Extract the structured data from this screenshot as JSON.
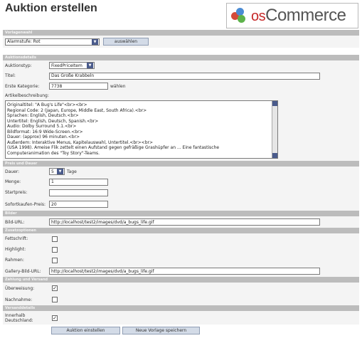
{
  "header": {
    "title": "Auktion erstellen",
    "logo_text_os": "os",
    "logo_text_main": "Commerce"
  },
  "sections": {
    "template": "Vorlagenwahl",
    "details": "Auktionsdetails",
    "price": "Preis und Dauer",
    "images": "Bilder",
    "options": "Zusatzoptionen",
    "shipping": "Zahlung und Versand",
    "other": "Versanddetails"
  },
  "template": {
    "value": "Alarmstufe: Rot",
    "button": "auswählen"
  },
  "details": {
    "type_label": "Auktionstyp:",
    "type_value": "FixedPriceItem",
    "title_label": "Titel:",
    "title_value": "Das Große Krabbeln",
    "category_label": "Erste Kategorie:",
    "category_value": "7738",
    "category_link": "wählen",
    "desc_label": "Artikelbeschreibung:",
    "desc_lines": [
      "Originaltitel: \"A Bug's Life\"<br><br>",
      "Regional Code: 2 (Japan, Europe, Middle East, South Africa).<br>",
      "Sprachen: English, Deutsch.<br>",
      "Untertitel: English, Deutsch, Spanish.<br>",
      "Audio: Dolby Surround 5.1.<br>",
      "Bildformat: 16:9 Wide-Screen.<br>",
      "Dauer: (approx) 96 minuten.<br>",
      "Außerdem: Interaktive Menus, Kapitelauswahl, Untertitel.<br><br>",
      "(USA 1998). Ameise Flik zettelt einen Aufstand gegen gefräßige Grashüpfer an ... Eine fantastische",
      "Computeranimation des \"Toy Story\"-Teams."
    ]
  },
  "price": {
    "duration_label": "Dauer:",
    "duration_value": "5",
    "duration_suffix": "Tage",
    "qty_label": "Menge:",
    "qty_value": "1",
    "start_label": "Startpreis:",
    "start_value": "",
    "buynow_label": "Sofortkaufen-Preis:",
    "buynow_value": "20"
  },
  "images": {
    "url_label": "Bild-URL:",
    "url_value": "http://localhost/test2/images/dvd/a_bugs_life.gif"
  },
  "options": {
    "bold_label": "Fettschrift:",
    "highlight_label": "Highlight:",
    "frame_label": "Rahmen:",
    "gallery_label": "Gallery-Bild-URL:",
    "gallery_value": "http://localhost/test2/images/dvd/a_bugs_life.gif"
  },
  "shipping": {
    "transfer_label": "Überweisung:",
    "transfer_checked": true,
    "cod_label": "Nachnahme:",
    "cod_checked": false
  },
  "other": {
    "domestic_label": "Innerhalb Deutschland:",
    "domestic_checked": true
  },
  "actions": {
    "create": "Auktion einstellen",
    "save_template": "Neue Vorlage speichern"
  },
  "colors": {
    "section_bg": "#bcbcbc",
    "row_bg": "#f4f4f4",
    "button_bg": "#d3dbe7",
    "logo_red": "#c62828"
  }
}
